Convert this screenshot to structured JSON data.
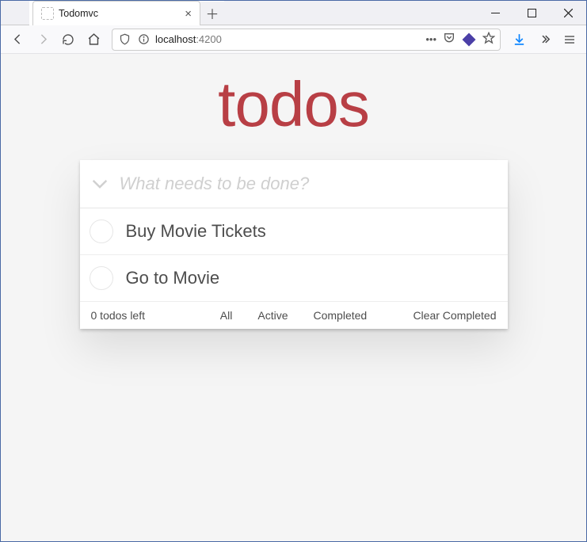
{
  "browser": {
    "tab_title": "Todomvc",
    "url_host": "localhost",
    "url_port": ":4200"
  },
  "app": {
    "title": "todos",
    "new_todo_placeholder": "What needs to be done?",
    "todos": [
      {
        "label": "Buy Movie Tickets",
        "completed": false
      },
      {
        "label": "Go to Movie",
        "completed": false
      }
    ],
    "footer": {
      "count_text": "0 todos left",
      "filters": {
        "all": "All",
        "active": "Active",
        "completed": "Completed"
      },
      "clear": "Clear Completed"
    }
  },
  "colors": {
    "accent": "#b83f45"
  }
}
